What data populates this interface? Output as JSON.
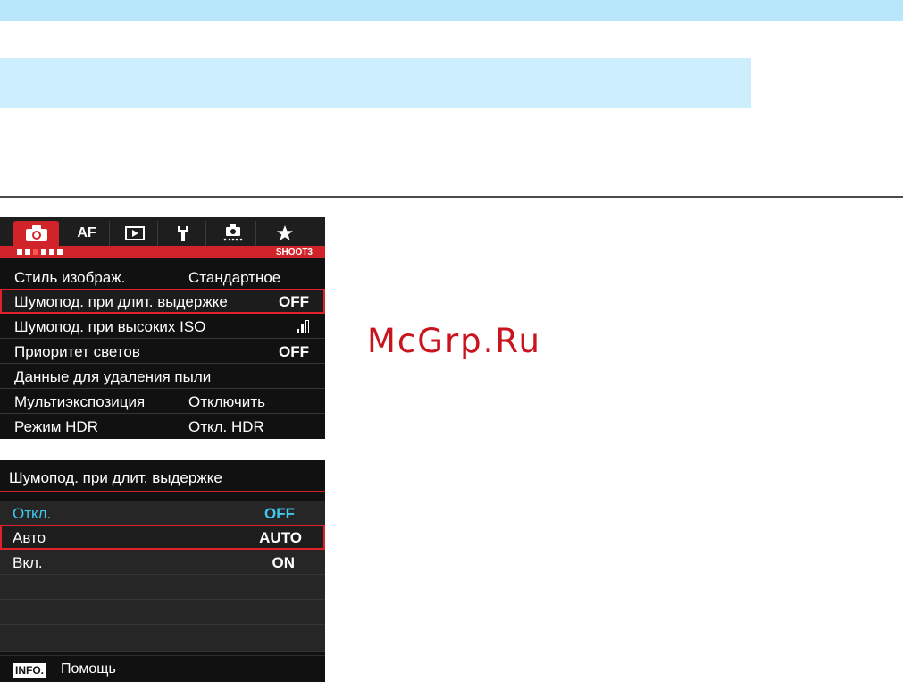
{
  "watermark": "McGrp.Ru",
  "colors": {
    "accent_red": "#d1232a",
    "highlight_blue": "#3fc6ee",
    "band_blue": "#cdeefd"
  },
  "shoot_menu": {
    "tabs": [
      {
        "icon": "camera-icon",
        "label": "",
        "active": true
      },
      {
        "icon": "af-label",
        "label": "AF"
      },
      {
        "icon": "playback-icon",
        "label": ""
      },
      {
        "icon": "wrench-icon",
        "label": ""
      },
      {
        "icon": "custom-functions-icon",
        "label": ""
      },
      {
        "icon": "star-icon",
        "label": ""
      }
    ],
    "page_id": "SHOOT3",
    "page_dots": 6,
    "current_dot": 3,
    "items": [
      {
        "label": "Стиль изображ.",
        "value": "Стандартное"
      },
      {
        "label": "Шумопод. при длит. выдержке",
        "value": "OFF",
        "selected": true
      },
      {
        "label": "Шумопод. при высоких ISO",
        "value": "",
        "icon": "noise-reduction-level-icon",
        "level": 2,
        "level_max": 3
      },
      {
        "label": "Приоритет светов",
        "value": "OFF"
      },
      {
        "label": "Данные для удаления пыли",
        "value": ""
      },
      {
        "label": "Мультиэкспозиция",
        "value": "Отключить"
      },
      {
        "label": "Режим HDR",
        "value": "Откл. HDR"
      }
    ]
  },
  "nr_submenu": {
    "title": "Шумопод. при длит. выдержке",
    "options": [
      {
        "label": "Откл.",
        "value": "OFF",
        "current": true
      },
      {
        "label": "Авто",
        "value": "AUTO",
        "selected": true
      },
      {
        "label": "Вкл.",
        "value": "ON"
      }
    ],
    "help_badge": "INFO.",
    "help_text": "Помощь"
  }
}
